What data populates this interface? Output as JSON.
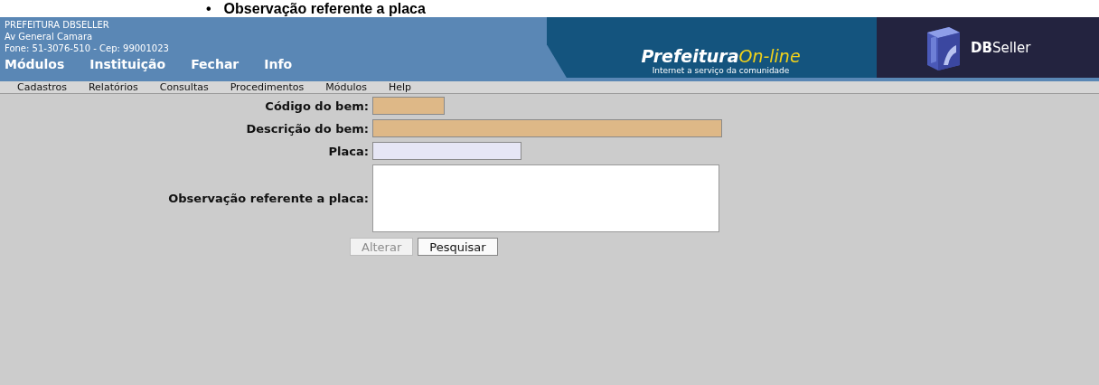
{
  "heading": {
    "bullet": "•",
    "text": "Observação referente a placa"
  },
  "header": {
    "info_lines": [
      "PREFEITURA DBSELLER",
      "Av General Camara",
      "Fone: 51-3076-510  -  Cep: 99001023"
    ],
    "top_menu": [
      "Módulos",
      "Instituição",
      "Fechar",
      "Info"
    ],
    "banner": {
      "brand_bold": "Prefeitura",
      "brand_light": "On-line",
      "tagline": "Internet a serviço da comunidade",
      "vendor_bold": "DB",
      "vendor_light": "Seller"
    }
  },
  "menu_bar": [
    "Cadastros",
    "Relatórios",
    "Consultas",
    "Procedimentos",
    "Módulos",
    "Help"
  ],
  "form": {
    "fields": [
      {
        "label": "Código do bem:",
        "kind": "input",
        "readonly": true
      },
      {
        "label": "Descrição do bem:",
        "kind": "input",
        "readonly": true
      },
      {
        "label": "Placa:",
        "kind": "input",
        "readonly": false
      },
      {
        "label": "Observação referente a placa:",
        "kind": "textarea",
        "readonly": false
      }
    ],
    "buttons": [
      {
        "label": "Alterar",
        "disabled": true
      },
      {
        "label": "Pesquisar",
        "disabled": false
      }
    ]
  }
}
